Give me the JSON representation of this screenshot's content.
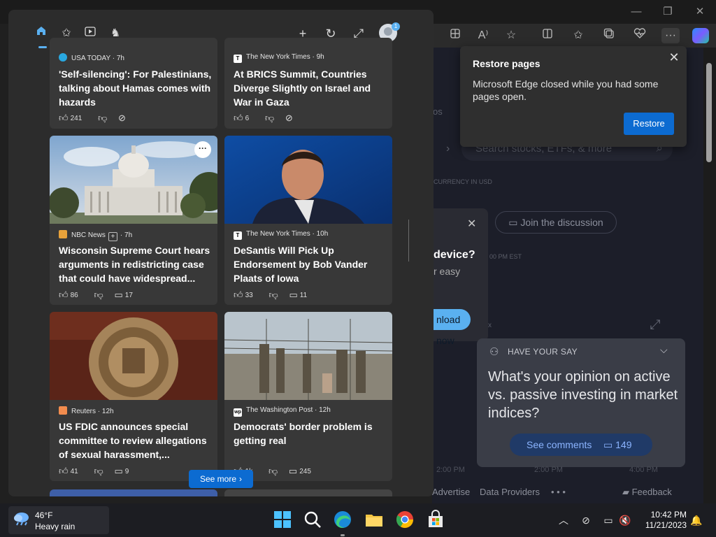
{
  "browser": {
    "window_controls": [
      "—",
      "❐",
      "✕"
    ],
    "toolbar_icons": [
      "tab-groups-icon",
      "read-aloud-icon",
      "favorite-star-icon",
      "split-screen-icon",
      "favorites-icon",
      "collections-icon",
      "browser-essentials-icon",
      "settings-more-icon",
      "copilot-icon"
    ],
    "read_aloud_glyph": "A⁾",
    "more_glyph": "···"
  },
  "restore_dialog": {
    "title": "Restore pages",
    "message": "Microsoft Edge closed while you had some pages open.",
    "button": "Restore",
    "close": "✕"
  },
  "background_page": {
    "fragment_os": "os",
    "search_placeholder": "Search stocks, ETFs, & more",
    "currency_note": "CURRENCY IN USD",
    "join_discussion": "Join the discussion",
    "time_note": "00 PM EST",
    "popup": {
      "line1": "device?",
      "line2": "r easy",
      "button": "nload now"
    },
    "fragment_x": "x",
    "have_your_say": {
      "label": "HAVE YOUR SAY",
      "question": "What's your opinion on active vs. passive investing in market indices?",
      "button": "See comments",
      "comment_count": "149"
    },
    "axis_labels": [
      "2:00 PM",
      "2:00 PM",
      "4:00 PM"
    ],
    "footer": {
      "advertise": "Advertise",
      "data_providers": "Data Providers",
      "dots": "• • •",
      "feedback": "Feedback"
    }
  },
  "widgets": {
    "tabs": [
      "home-icon",
      "favorites-icon",
      "video-icon",
      "games-icon"
    ],
    "actions": {
      "add": "+",
      "refresh": "↻",
      "expand": "⤢"
    },
    "avatar_badge": "1",
    "cards": [
      {
        "source": "USA TODAY",
        "age": "· 7h",
        "headline": "'Self-silencing': For Palestinians, talking about Hamas comes with hazards",
        "likes": "241",
        "comments": ""
      },
      {
        "source": "The New York Times",
        "age": "· 9h",
        "headline": "At BRICS Summit, Countries Diverge Slightly on Israel and War in Gaza",
        "likes": "6",
        "comments": ""
      },
      {
        "source": "NBC News",
        "follow": "+",
        "age": "· 7h",
        "headline": "Wisconsin Supreme Court hears arguments in redistricting case that could have widespread...",
        "likes": "86",
        "comments": "17",
        "more": "···"
      },
      {
        "source": "The New York Times",
        "age": "· 10h",
        "headline": "DeSantis Will Pick Up Endorsement by Bob Vander Plaats of Iowa",
        "likes": "33",
        "comments": "11"
      },
      {
        "source": "Reuters",
        "age": "· 12h",
        "headline": "US FDIC announces special committee to review allegations of sexual harassment,...",
        "likes": "41",
        "comments": "9"
      },
      {
        "source": "The Washington Post",
        "age": "· 12h",
        "headline": "Democrats' border problem is getting real",
        "likes": "1k",
        "comments": "245"
      }
    ],
    "source_logos": {
      "usa_today": "#29a8e0",
      "nyt": "T",
      "nbc": "#e8a23a",
      "reuters": "#f28c4e",
      "wapo": "wp"
    },
    "see_more": "See more",
    "see_more_chevron": "›"
  },
  "taskbar": {
    "weather": {
      "temp": "46°F",
      "condition": "Heavy rain"
    },
    "apps": [
      "start-icon",
      "search-icon",
      "edge-icon",
      "file-explorer-icon",
      "chrome-icon",
      "store-icon"
    ],
    "tray": {
      "chevron": "︿",
      "network": "⊘",
      "display": "▭",
      "volume": "🔇",
      "notifications": "🔔"
    },
    "time": "10:42 PM",
    "date": "11/21/2023"
  },
  "colors": {
    "accent": "#0c6bd1",
    "widget_bg": "#2c2c2c",
    "card_bg": "#383838",
    "active_tab": "#5ab0f0"
  }
}
